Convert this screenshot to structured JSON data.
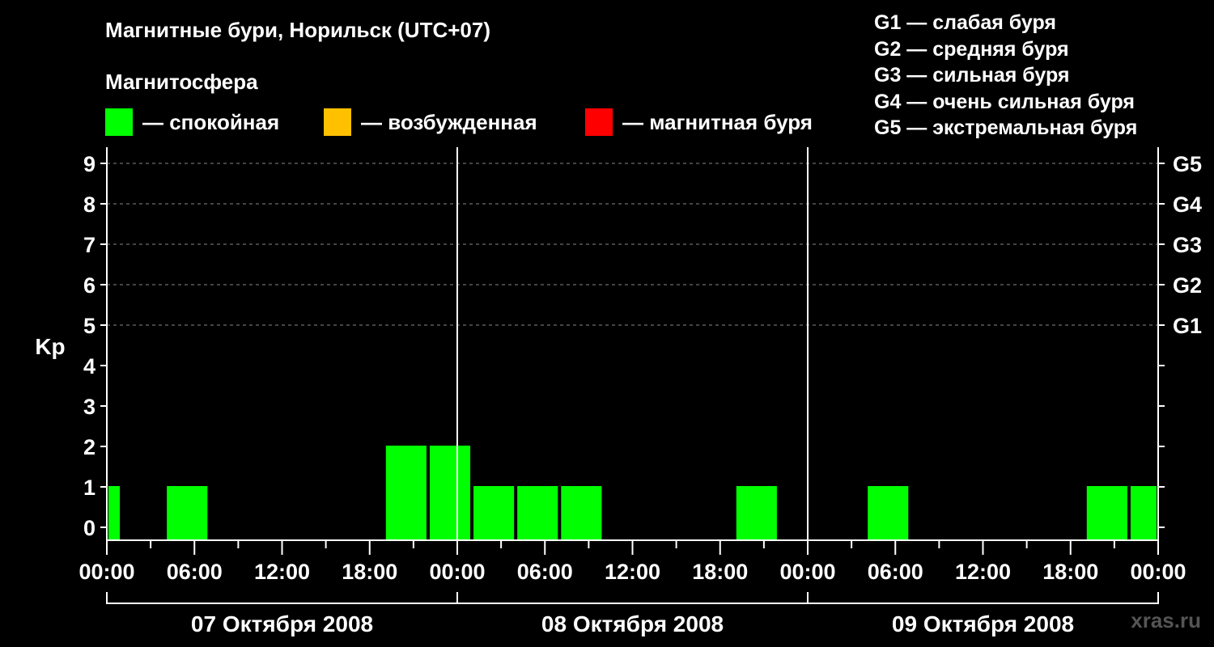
{
  "header": {
    "title": "Магнитные бури, Норильск (UTC+07)",
    "subtitle": "Магнитосфера"
  },
  "legend": [
    {
      "label": "— спокойная",
      "color": "#00ff00"
    },
    {
      "label": "— возбужденная",
      "color": "#ffc000"
    },
    {
      "label": "— магнитная буря",
      "color": "#ff0000"
    }
  ],
  "g_legend": [
    "G1 — слабая буря",
    "G2 — средняя буря",
    "G3 — сильная буря",
    "G4 — очень сильная буря",
    "G5 — экстремальная буря"
  ],
  "watermark": "xras.ru",
  "chart_data": {
    "type": "bar",
    "ylabel": "Kp",
    "ylim": [
      0,
      9
    ],
    "y_ticks": [
      "0",
      "1",
      "2",
      "3",
      "4",
      "5",
      "6",
      "7",
      "8",
      "9"
    ],
    "right_ticks": [
      {
        "value": 5,
        "label": "G1"
      },
      {
        "value": 6,
        "label": "G2"
      },
      {
        "value": 7,
        "label": "G3"
      },
      {
        "value": 8,
        "label": "G4"
      },
      {
        "value": 9,
        "label": "G5"
      }
    ],
    "x_tick_labels": [
      "00:00",
      "06:00",
      "12:00",
      "18:00",
      "00:00",
      "06:00",
      "12:00",
      "18:00",
      "00:00",
      "06:00",
      "12:00",
      "18:00",
      "00:00"
    ],
    "days": [
      "07 Октября 2008",
      "08 Октября 2008",
      "09 Октября 2008"
    ],
    "x_unit": "hours since 07 Октября 2008 00:00 (UTC+07)",
    "bars": [
      {
        "start": 0,
        "end": 1,
        "value": 1,
        "level": "quiet"
      },
      {
        "start": 4,
        "end": 7,
        "value": 1,
        "level": "quiet"
      },
      {
        "start": 19,
        "end": 22,
        "value": 2,
        "level": "quiet"
      },
      {
        "start": 22,
        "end": 25,
        "value": 2,
        "level": "quiet"
      },
      {
        "start": 25,
        "end": 28,
        "value": 1,
        "level": "quiet"
      },
      {
        "start": 28,
        "end": 31,
        "value": 1,
        "level": "quiet"
      },
      {
        "start": 31,
        "end": 34,
        "value": 1,
        "level": "quiet"
      },
      {
        "start": 43,
        "end": 46,
        "value": 1,
        "level": "quiet"
      },
      {
        "start": 52,
        "end": 55,
        "value": 1,
        "level": "quiet"
      },
      {
        "start": 67,
        "end": 70,
        "value": 1,
        "level": "quiet"
      },
      {
        "start": 70,
        "end": 72,
        "value": 1,
        "level": "quiet"
      }
    ],
    "colors": {
      "quiet": "#00ff00",
      "active": "#ffc000",
      "storm": "#ff0000"
    },
    "grid": "dashed horizontal at Kp 5–9"
  }
}
